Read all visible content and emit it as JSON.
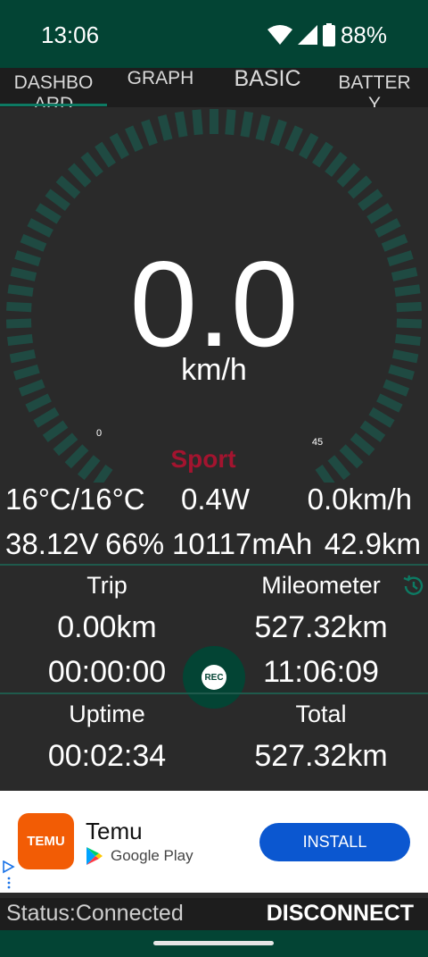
{
  "status_bar": {
    "time": "13:06",
    "battery_pct": "88%"
  },
  "tabs": [
    "DASHBOARD",
    "GRAPH",
    "BASIC",
    "BATTERY"
  ],
  "gauge": {
    "speed": "0.0",
    "unit": "km/h",
    "min_label": "0",
    "max_label": "45",
    "mode": "Sport"
  },
  "stats_row1": {
    "temperature": "16°C/16°C",
    "power": "0.4W",
    "avg_speed": "0.0km/h"
  },
  "stats_row2": {
    "voltage": "38.12V",
    "battery": "66%",
    "capacity": "10117mAh",
    "range": "42.9km"
  },
  "trip": {
    "label": "Trip",
    "distance": "0.00km",
    "time": "00:00:00"
  },
  "mileometer": {
    "label": "Mileometer",
    "distance": "527.32km",
    "time": "11:06:09"
  },
  "rec_button": {
    "label": "REC"
  },
  "uptime": {
    "label": "Uptime",
    "value": "00:02:34"
  },
  "total": {
    "label": "Total",
    "value": "527.32km"
  },
  "ad": {
    "logo_text": "TEMU",
    "app_name": "Temu",
    "store": "Google Play",
    "install_label": "INSTALL"
  },
  "bottom_bar": {
    "status": "Status:Connected",
    "disconnect_label": "DISCONNECT"
  },
  "colors": {
    "accent": "#034434",
    "mode": "#a3142f",
    "tick": "#1f4a42",
    "install": "#0b57d0",
    "logo": "#f25c05"
  }
}
